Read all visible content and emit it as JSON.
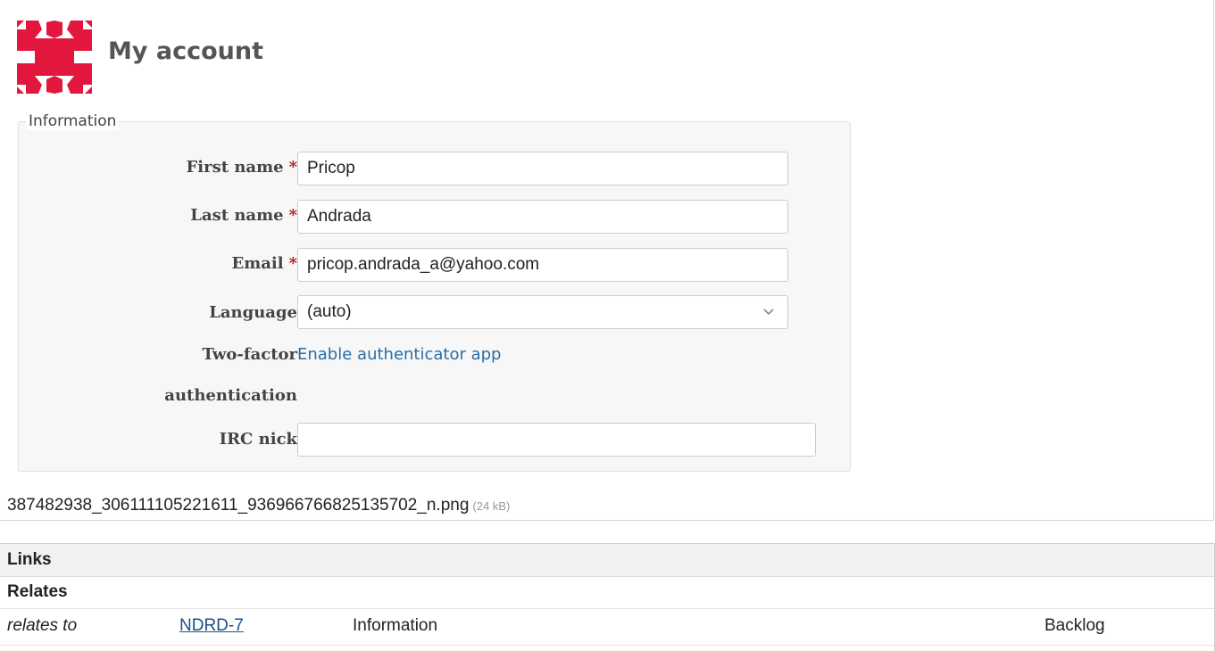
{
  "page": {
    "title": "My account",
    "brand_color": "#e3173e"
  },
  "form": {
    "legend": "Information",
    "first_name": {
      "label": "First name",
      "required_mark": "*",
      "value": "Pricop"
    },
    "last_name": {
      "label": "Last name",
      "required_mark": "*",
      "value": "Andrada"
    },
    "email": {
      "label": "Email",
      "required_mark": "*",
      "value": "pricop.andrada_a@yahoo.com"
    },
    "language": {
      "label": "Language",
      "value": "(auto)"
    },
    "two_factor": {
      "label_line1": "Two-factor",
      "label_line2": "authentication",
      "link": "Enable authenticator app"
    },
    "irc_nick": {
      "label": "IRC nick",
      "value": ""
    }
  },
  "attachment": {
    "filename": "387482938_306111105221611_936966766825135702_n.png",
    "size": "(24 kB)"
  },
  "links": {
    "heading": "Links",
    "group": "Relates",
    "rows": [
      {
        "relation": "relates to",
        "key": "NDRD-7",
        "summary": "Information",
        "status": "Backlog"
      }
    ]
  }
}
